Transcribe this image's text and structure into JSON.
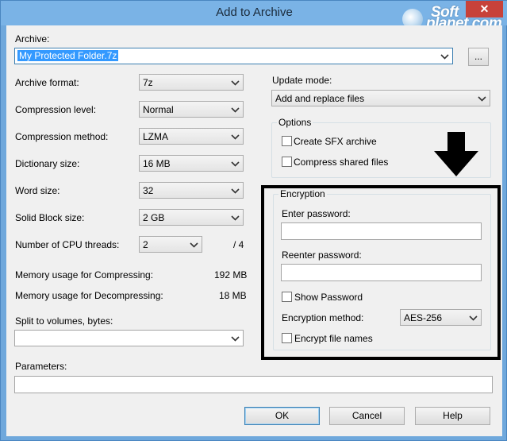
{
  "window": {
    "title": "Add to Archive",
    "close_glyph": "✕"
  },
  "watermark": {
    "line1": "Soft",
    "line2": "planet.com"
  },
  "archive": {
    "label": "Archive:",
    "value": "My Protected Folder.7z",
    "browse_label": "..."
  },
  "left": {
    "archive_format": {
      "label": "Archive format:",
      "value": "7z"
    },
    "compression_level": {
      "label": "Compression level:",
      "value": "Normal"
    },
    "compression_method": {
      "label": "Compression method:",
      "value": "LZMA"
    },
    "dictionary_size": {
      "label": "Dictionary size:",
      "value": "16 MB"
    },
    "word_size": {
      "label": "Word size:",
      "value": "32"
    },
    "solid_block_size": {
      "label": "Solid Block size:",
      "value": "2 GB"
    },
    "cpu_threads": {
      "label": "Number of CPU threads:",
      "value": "2",
      "total": "/ 4"
    },
    "mem_compress": {
      "label": "Memory usage for Compressing:",
      "value": "192 MB"
    },
    "mem_decompress": {
      "label": "Memory usage for Decompressing:",
      "value": "18 MB"
    },
    "split": {
      "label": "Split to volumes, bytes:",
      "value": ""
    }
  },
  "parameters": {
    "label": "Parameters:",
    "value": ""
  },
  "right": {
    "update_mode": {
      "label": "Update mode:",
      "value": "Add and replace files"
    },
    "options": {
      "title": "Options",
      "create_sfx": {
        "label": "Create SFX archive",
        "checked": false
      },
      "compress_shared": {
        "label": "Compress shared files",
        "checked": false
      }
    },
    "encryption": {
      "title": "Encryption",
      "enter_password_label": "Enter password:",
      "reenter_password_label": "Reenter password:",
      "show_password": {
        "label": "Show Password",
        "checked": false
      },
      "method_label": "Encryption method:",
      "method_value": "AES-256",
      "encrypt_names": {
        "label": "Encrypt file names",
        "checked": false
      }
    }
  },
  "buttons": {
    "ok": "OK",
    "cancel": "Cancel",
    "help": "Help"
  },
  "colors": {
    "highlight_border": "#000000",
    "title_bar": "#7ab3e6",
    "close_button": "#c7423a"
  }
}
